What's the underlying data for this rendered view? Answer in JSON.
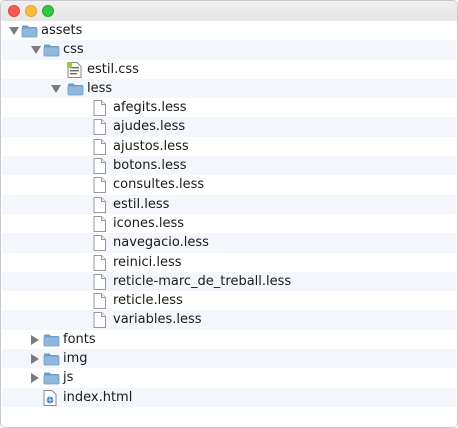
{
  "window": {
    "buttons": [
      "close",
      "minimize",
      "zoom"
    ]
  },
  "tree": [
    {
      "label": "assets",
      "type": "folder",
      "depth": 0,
      "expanded": true,
      "icon": "folder-icon"
    },
    {
      "label": "css",
      "type": "folder",
      "depth": 1,
      "expanded": true,
      "icon": "folder-icon"
    },
    {
      "label": "estil.css",
      "type": "file",
      "depth": 2,
      "icon": "css-file-icon"
    },
    {
      "label": "less",
      "type": "folder",
      "depth": 2,
      "expanded": true,
      "icon": "folder-icon"
    },
    {
      "label": "afegits.less",
      "type": "file",
      "depth": 3,
      "icon": "file-icon"
    },
    {
      "label": "ajudes.less",
      "type": "file",
      "depth": 3,
      "icon": "file-icon"
    },
    {
      "label": "ajustos.less",
      "type": "file",
      "depth": 3,
      "icon": "file-icon"
    },
    {
      "label": "botons.less",
      "type": "file",
      "depth": 3,
      "icon": "file-icon"
    },
    {
      "label": "consultes.less",
      "type": "file",
      "depth": 3,
      "icon": "file-icon"
    },
    {
      "label": "estil.less",
      "type": "file",
      "depth": 3,
      "icon": "file-icon"
    },
    {
      "label": "icones.less",
      "type": "file",
      "depth": 3,
      "icon": "file-icon"
    },
    {
      "label": "navegacio.less",
      "type": "file",
      "depth": 3,
      "icon": "file-icon"
    },
    {
      "label": "reinici.less",
      "type": "file",
      "depth": 3,
      "icon": "file-icon"
    },
    {
      "label": "reticle-marc_de_treball.less",
      "type": "file",
      "depth": 3,
      "icon": "file-icon"
    },
    {
      "label": "reticle.less",
      "type": "file",
      "depth": 3,
      "icon": "file-icon"
    },
    {
      "label": "variables.less",
      "type": "file",
      "depth": 3,
      "icon": "file-icon"
    },
    {
      "label": "fonts",
      "type": "folder",
      "depth": 1,
      "expanded": false,
      "icon": "folder-icon"
    },
    {
      "label": "img",
      "type": "folder",
      "depth": 1,
      "expanded": false,
      "icon": "folder-icon"
    },
    {
      "label": "js",
      "type": "folder",
      "depth": 1,
      "expanded": false,
      "icon": "folder-icon"
    },
    {
      "label": "index.html",
      "type": "file",
      "depth": 1,
      "icon": "html-file-icon"
    }
  ],
  "colors": {
    "folder": "#8fb8dc",
    "folder_dark": "#6c9cc7",
    "row_alt": "#f3f6fa",
    "disclosure": "#7b7b7b"
  }
}
